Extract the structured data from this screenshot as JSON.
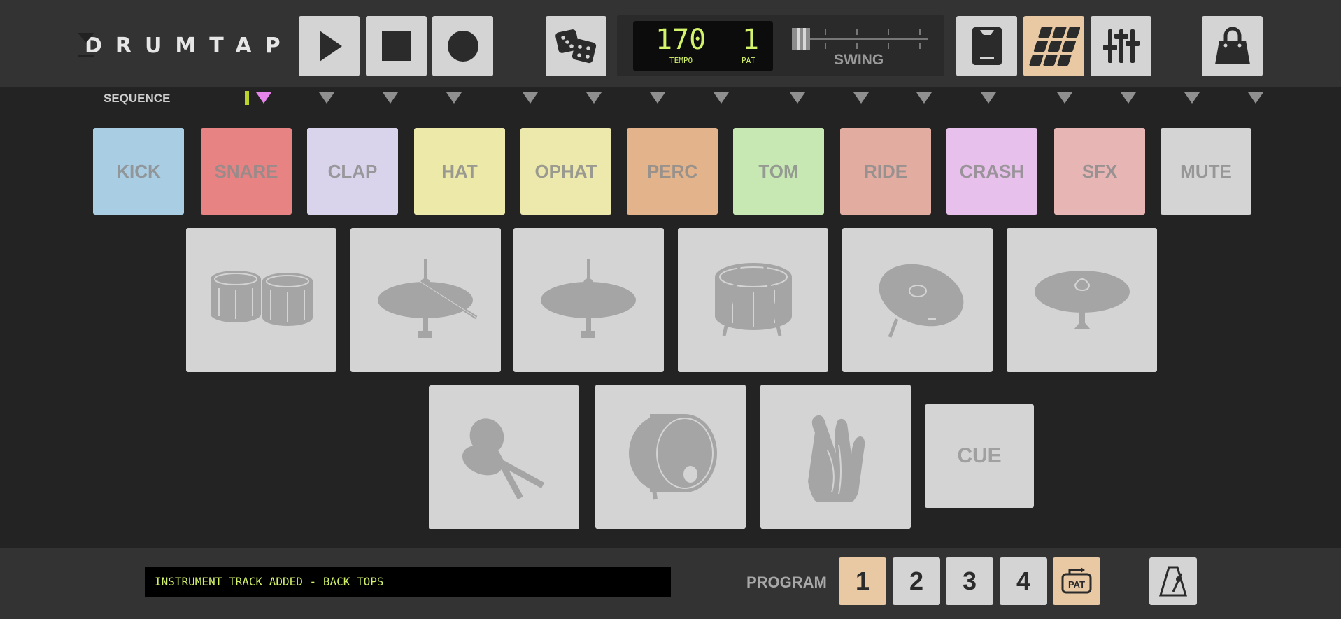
{
  "app": {
    "name": "DRUMTAP"
  },
  "transport": {
    "play": "play-icon",
    "stop": "stop-icon",
    "record": "record-icon",
    "randomize": "dice-icon"
  },
  "display": {
    "tempo_value": "170",
    "tempo_label": "TEMPO",
    "pattern_value": "1",
    "pattern_label": "PAT",
    "swing_label": "SWING",
    "swing_value": 0
  },
  "toolbar": {
    "icons": [
      "phone-icon",
      "pad-grid-icon",
      "mixer-icon",
      "shop-bag-icon"
    ]
  },
  "sequence": {
    "label": "SEQUENCE",
    "current_step": 1,
    "steps": 16
  },
  "instruments": [
    {
      "label": "KICK",
      "color": "#a9cde3"
    },
    {
      "label": "SNARE",
      "color": "#e88383"
    },
    {
      "label": "CLAP",
      "color": "#d9d3ec"
    },
    {
      "label": "HAT",
      "color": "#ede9a9"
    },
    {
      "label": "OPHAT",
      "color": "#ede9ac"
    },
    {
      "label": "PERC",
      "color": "#e3b38b"
    },
    {
      "label": "TOM",
      "color": "#c7e8b2"
    },
    {
      "label": "RIDE",
      "color": "#e2aca1"
    },
    {
      "label": "CRASH",
      "color": "#e8c0ec"
    },
    {
      "label": "SFX",
      "color": "#e8b5b5"
    },
    {
      "label": "MUTE",
      "color": "#d4d4d4"
    }
  ],
  "drum_pads": [
    {
      "icon": "toms-icon"
    },
    {
      "icon": "hihat-stick-icon"
    },
    {
      "icon": "hihat-icon"
    },
    {
      "icon": "snare-drum-icon"
    },
    {
      "icon": "crash-cymbal-icon"
    },
    {
      "icon": "ride-cymbal-icon"
    },
    {
      "icon": "maracas-icon"
    },
    {
      "icon": "bass-drum-icon"
    },
    {
      "icon": "clap-hands-icon"
    }
  ],
  "cue": {
    "label": "CUE"
  },
  "status": {
    "message": "INSTRUMENT TRACK ADDED - BACK TOPS"
  },
  "program": {
    "label": "PROGRAM",
    "slots": [
      "1",
      "2",
      "3",
      "4"
    ],
    "active": "1",
    "pattern_button": "PAT"
  },
  "metronome": "metronome-icon",
  "colors": {
    "accent": "#e9c9a4",
    "lcd_text": "#d3f36b",
    "playhead": "#e585ea",
    "step_indicator": "#b9d22c"
  }
}
